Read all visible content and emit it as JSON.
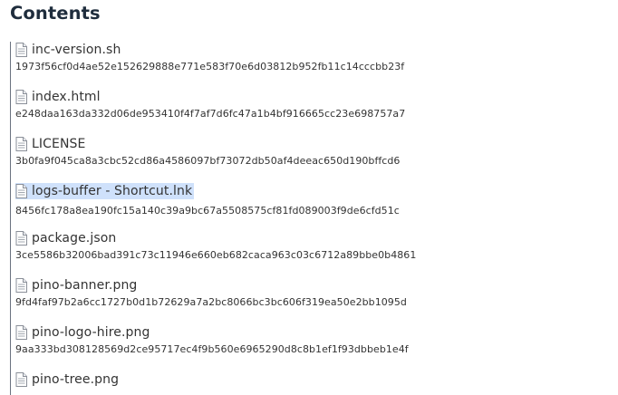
{
  "header": {
    "title": "Contents"
  },
  "files": [
    {
      "name": "inc-version.sh",
      "hash": "1973f56cf0d4ae52e152629888e771e583f70e6d03812b952fb11c14cccbb23f",
      "icon": "file-icon",
      "selected": false
    },
    {
      "name": "index.html",
      "hash": "e248daa163da332d06de953410f4f7af7d6fc47a1b4bf916665cc23e698757a7",
      "icon": "file-icon",
      "selected": false
    },
    {
      "name": "LICENSE",
      "hash": "3b0fa9f045ca8a3cbc52cd86a4586097bf73072db50af4deeac650d190bffcd6",
      "icon": "file-icon",
      "selected": false
    },
    {
      "name": "logs-buffer - Shortcut.lnk",
      "hash": "8456fc178a8ea190fc15a140c39a9bc67a5508575cf81fd089003f9de6cfd51c",
      "icon": "file-icon",
      "selected": true
    },
    {
      "name": "package.json",
      "hash": "3ce5586b32006bad391c73c11946e660eb682caca963c03c6712a89bbe0b4861",
      "icon": "file-icon",
      "selected": false
    },
    {
      "name": "pino-banner.png",
      "hash": "9fd4faf97b2a6cc1727b0d1b72629a7a2bc8066bc3bc606f319ea50e2bb1095d",
      "icon": "file-icon",
      "selected": false
    },
    {
      "name": "pino-logo-hire.png",
      "hash": "9aa333bd308128569d2ce95717ec4f9b560e6965290d8c8b1ef1f93dbbeb1e4f",
      "icon": "file-icon",
      "selected": false
    },
    {
      "name": "pino-tree.png",
      "hash": "",
      "icon": "file-icon",
      "selected": false
    }
  ],
  "colors": {
    "selection": "#cfe1fb",
    "text": "#333333",
    "heading": "#1f2d3d"
  }
}
